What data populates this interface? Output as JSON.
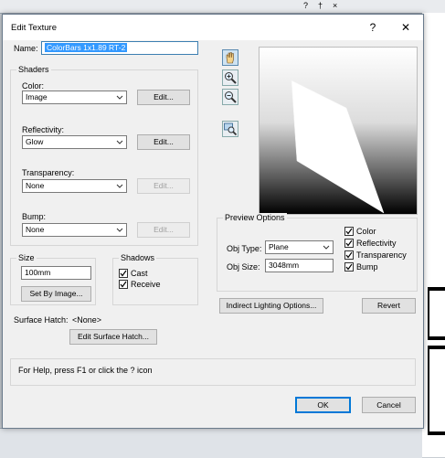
{
  "background": {
    "topbar_glyphs": [
      "?",
      "†",
      "×"
    ]
  },
  "dialog": {
    "title": "Edit Texture",
    "help_btn": "?",
    "close_btn": "✕",
    "name_label": "Name:",
    "name_value": "ColorBars 1x1.89 RT-2",
    "shaders": {
      "title": "Shaders",
      "color_label": "Color:",
      "color_value": "Image",
      "color_edit": "Edit...",
      "reflectivity_label": "Reflectivity:",
      "reflectivity_value": "Glow",
      "reflectivity_edit": "Edit...",
      "transparency_label": "Transparency:",
      "transparency_value": "None",
      "transparency_edit": "Edit...",
      "bump_label": "Bump:",
      "bump_value": "None",
      "bump_edit": "Edit..."
    },
    "size": {
      "title": "Size",
      "value": "100mm",
      "set_by_image": "Set By Image..."
    },
    "shadows": {
      "title": "Shadows",
      "cast": "Cast",
      "receive": "Receive"
    },
    "surface_hatch": {
      "label": "Surface Hatch:",
      "value": "<None>",
      "button": "Edit Surface Hatch..."
    },
    "preview_options": {
      "title": "Preview Options",
      "obj_type_label": "Obj Type:",
      "obj_type_value": "Plane",
      "obj_size_label": "Obj Size:",
      "obj_size_value": "3048mm",
      "color": "Color",
      "reflectivity": "Reflectivity",
      "transparency": "Transparency",
      "bump": "Bump"
    },
    "indirect_lighting": "Indirect Lighting Options...",
    "revert": "Revert",
    "help_text": "For Help, press F1 or click the ? icon",
    "ok": "OK",
    "cancel": "Cancel"
  }
}
